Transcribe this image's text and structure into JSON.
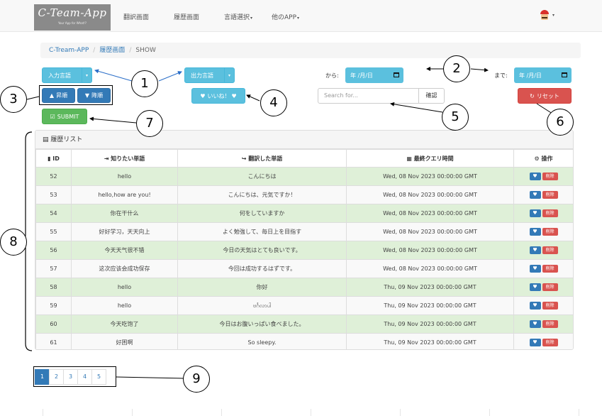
{
  "navbar": {
    "logo_title": "C-Team-App",
    "logo_subtitle": "Your App for What!?",
    "items": [
      "翻訳画面",
      "履歴画面",
      "言語選択",
      "他のAPP"
    ],
    "caret": "▾"
  },
  "breadcrumb": {
    "items": [
      "C-Tream-APP",
      "履歴画面",
      "SHOW"
    ],
    "separator": "/"
  },
  "controls": {
    "input_lang_label": "入力言語",
    "output_lang_label": "出力言語",
    "asc_label": "昇順",
    "desc_label": "降順",
    "like_label": "いいね！",
    "submit_label": "SUBMIT",
    "from_label": "から:",
    "to_label": "まで:",
    "date_value": "年 /月/日",
    "search_placeholder": "Search for...",
    "search_button": "確認",
    "reset_label": "リセット"
  },
  "panel": {
    "title": "履歴リスト",
    "columns": [
      "ID",
      "知りたい単語",
      "翻訳した単語",
      "最終クエリ時間",
      "操作"
    ],
    "delete_label": "削除",
    "rows": [
      {
        "id": "52",
        "source": "hello",
        "translated": "こんにちは",
        "time": "Wed, 08 Nov 2023 00:00:00 GMT"
      },
      {
        "id": "53",
        "source": "hello,how are you!",
        "translated": "こんにちは、元気ですか！",
        "time": "Wed, 08 Nov 2023 00:00:00 GMT"
      },
      {
        "id": "54",
        "source": "你在干什么",
        "translated": "何をしていますか",
        "time": "Wed, 08 Nov 2023 00:00:00 GMT"
      },
      {
        "id": "55",
        "source": "好好学习，天天向上",
        "translated": "よく勉強して、毎日上を目指す",
        "time": "Wed, 08 Nov 2023 00:00:00 GMT"
      },
      {
        "id": "56",
        "source": "今天天气很不错",
        "translated": "今日の天気はとても良いです。",
        "time": "Wed, 08 Nov 2023 00:00:00 GMT"
      },
      {
        "id": "57",
        "source": "这次应该会成功保存",
        "translated": "今回は成功するはずです。",
        "time": "Wed, 08 Nov 2023 00:00:00 GMT"
      },
      {
        "id": "58",
        "source": "hello",
        "translated": "你好",
        "time": "Thu, 09 Nov 2023 00:00:00 GMT"
      },
      {
        "id": "59",
        "source": "hello",
        "translated": "ဗင်္ဂလာပါ",
        "time": "Thu, 09 Nov 2023 00:00:00 GMT"
      },
      {
        "id": "60",
        "source": "今天吃饱了",
        "translated": "今日はお腹いっぱい食べました。",
        "time": "Thu, 09 Nov 2023 00:00:00 GMT"
      },
      {
        "id": "61",
        "source": "好困啊",
        "translated": "So sleepy.",
        "time": "Thu, 09 Nov 2023 00:00:00 GMT"
      }
    ]
  },
  "pagination": {
    "pages": [
      "1",
      "2",
      "3",
      "4",
      "5"
    ],
    "active": "1"
  },
  "callouts": [
    "1",
    "2",
    "3",
    "4",
    "5",
    "6",
    "7",
    "8",
    "9"
  ]
}
